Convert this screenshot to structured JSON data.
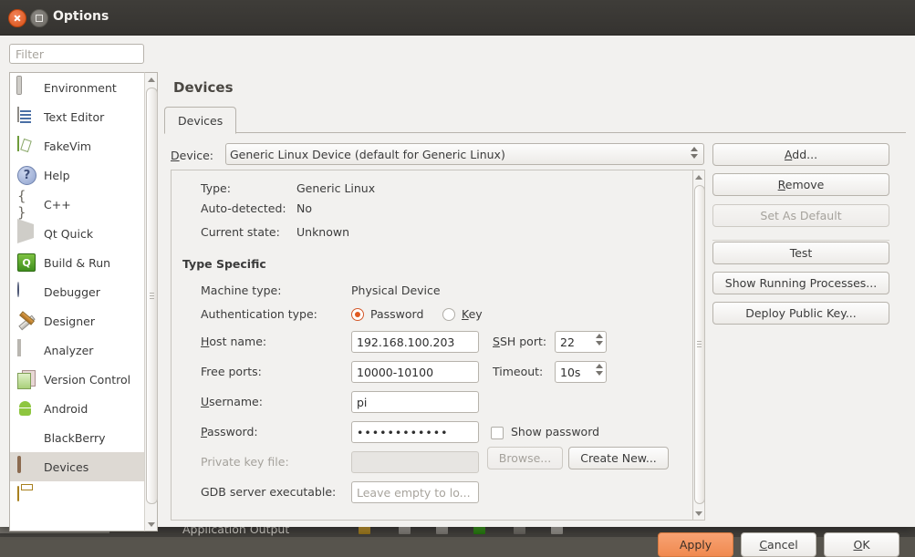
{
  "window": {
    "title": "Options",
    "close_icon": "close-icon",
    "maximize_icon": "maximize-icon"
  },
  "filter": {
    "placeholder": "Filter",
    "value": ""
  },
  "sidebar": {
    "items": [
      {
        "label": "Environment",
        "icon": "environment-icon",
        "selected": false
      },
      {
        "label": "Text Editor",
        "icon": "text-editor-icon",
        "selected": false
      },
      {
        "label": "FakeVim",
        "icon": "fakevim-icon",
        "selected": false
      },
      {
        "label": "Help",
        "icon": "help-icon",
        "selected": false
      },
      {
        "label": "C++",
        "icon": "cpp-icon",
        "selected": false
      },
      {
        "label": "Qt Quick",
        "icon": "qt-quick-icon",
        "selected": false
      },
      {
        "label": "Build & Run",
        "icon": "build-run-icon",
        "selected": false
      },
      {
        "label": "Debugger",
        "icon": "debugger-icon",
        "selected": false
      },
      {
        "label": "Designer",
        "icon": "designer-icon",
        "selected": false
      },
      {
        "label": "Analyzer",
        "icon": "analyzer-icon",
        "selected": false
      },
      {
        "label": "Version Control",
        "icon": "version-control-icon",
        "selected": false
      },
      {
        "label": "Android",
        "icon": "android-icon",
        "selected": false
      },
      {
        "label": "BlackBerry",
        "icon": "blackberry-icon",
        "selected": false
      },
      {
        "label": "Devices",
        "icon": "devices-icon",
        "selected": true
      }
    ]
  },
  "page": {
    "title": "Devices",
    "tabs": [
      {
        "label": "Devices",
        "active": true
      }
    ]
  },
  "device_row": {
    "label": "Device:",
    "label_mnemonic": "D",
    "value": "Generic Linux Device (default for Generic Linux)"
  },
  "details": {
    "info": [
      {
        "key": "Type:",
        "value": "Generic Linux"
      },
      {
        "key": "Auto-detected:",
        "value": "No"
      },
      {
        "key": "Current state:",
        "value": "Unknown"
      }
    ],
    "section_title": "Type Specific",
    "machine_type": {
      "label": "Machine type:",
      "value": "Physical Device"
    },
    "auth_type": {
      "label": "Authentication type:",
      "options": [
        {
          "label": "Password",
          "mnemonic": "",
          "selected": true
        },
        {
          "label": "Key",
          "mnemonic": "K",
          "selected": false
        }
      ]
    },
    "host_name": {
      "label": "Host name:",
      "mnemonic": "H",
      "value": "192.168.100.203"
    },
    "ssh_port": {
      "label": "SSH port:",
      "mnemonic": "S",
      "value": "22"
    },
    "free_ports": {
      "label": "Free ports:",
      "value": "10000-10100"
    },
    "timeout": {
      "label": "Timeout:",
      "value": "10s"
    },
    "username": {
      "label": "Username:",
      "mnemonic": "U",
      "value": "pi"
    },
    "password": {
      "label": "Password:",
      "mnemonic": "P",
      "value": "••••••••••••"
    },
    "show_password": {
      "label": "Show password",
      "checked": false
    },
    "private_key": {
      "label": "Private key file:",
      "value": "",
      "disabled": true
    },
    "browse_button": {
      "label": "Browse...",
      "disabled": true
    },
    "create_new_button": {
      "label": "Create New...",
      "disabled": false
    },
    "gdb_server": {
      "label": "GDB server executable:",
      "placeholder": "Leave empty to lo...",
      "value": ""
    }
  },
  "side_buttons": [
    {
      "label": "Add...",
      "mnemonic": "A",
      "disabled": false
    },
    {
      "label": "Remove",
      "mnemonic": "R",
      "disabled": false
    },
    {
      "label": "Set As Default",
      "mnemonic": "",
      "disabled": true
    },
    {
      "label": "Test",
      "mnemonic": "",
      "disabled": false
    },
    {
      "label": "Show Running Processes...",
      "mnemonic": "",
      "disabled": false
    },
    {
      "label": "Deploy Public Key...",
      "mnemonic": "",
      "disabled": false
    }
  ],
  "footer": {
    "apply": "Apply",
    "cancel": "Cancel",
    "cancel_mnemonic": "C",
    "ok": "OK",
    "ok_mnemonic": "O"
  },
  "background": {
    "panel_title": "Application Output"
  },
  "colors": {
    "accent_apply": "#f08a50",
    "radio_selected": "#e05a22",
    "titlebar": "#3c3a36",
    "dialog_bg": "#f2f1ef",
    "selection": "#ddd9d3"
  }
}
